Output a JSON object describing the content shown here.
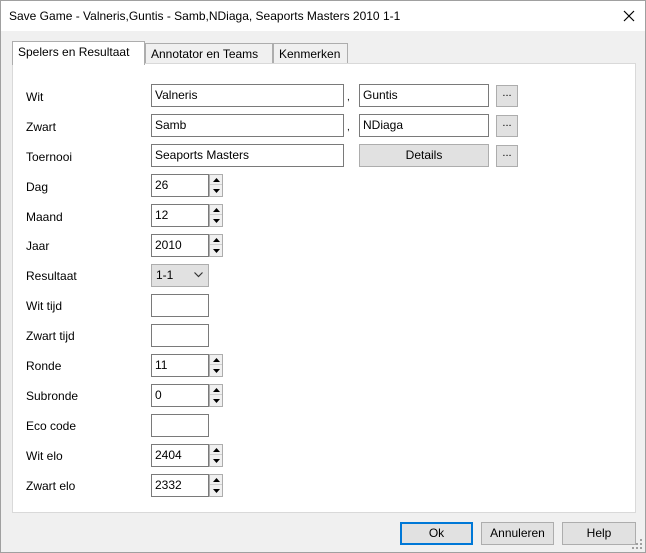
{
  "window": {
    "title": "Save Game - Valneris,Guntis - Samb,NDiaga, Seaports Masters 2010 1-1"
  },
  "tabs": [
    {
      "label": "Spelers en Resultaat"
    },
    {
      "label": "Annotator en Teams"
    },
    {
      "label": "Kenmerken"
    }
  ],
  "form": {
    "wit_label": "Wit",
    "wit_last": "Valneris",
    "wit_first": "Guntis",
    "zwart_label": "Zwart",
    "zwart_last": "Samb",
    "zwart_first": "NDiaga",
    "toernooi_label": "Toernooi",
    "toernooi_value": "Seaports Masters",
    "details_label": "Details",
    "dots_label": "...",
    "name_separator": ",",
    "dag_label": "Dag",
    "dag_value": "26",
    "maand_label": "Maand",
    "maand_value": "12",
    "jaar_label": "Jaar",
    "jaar_value": "2010",
    "resultaat_label": "Resultaat",
    "resultaat_value": "1-1",
    "wit_tijd_label": "Wit tijd",
    "wit_tijd_value": "",
    "zwart_tijd_label": "Zwart tijd",
    "zwart_tijd_value": "",
    "ronde_label": "Ronde",
    "ronde_value": "11",
    "subronde_label": "Subronde",
    "subronde_value": "0",
    "eco_label": "Eco code",
    "eco_value": "",
    "wit_elo_label": "Wit elo",
    "wit_elo_value": "2404",
    "zwart_elo_label": "Zwart elo",
    "zwart_elo_value": "2332"
  },
  "footer": {
    "ok_label": "Ok",
    "cancel_label": "Annuleren",
    "help_label": "Help"
  }
}
